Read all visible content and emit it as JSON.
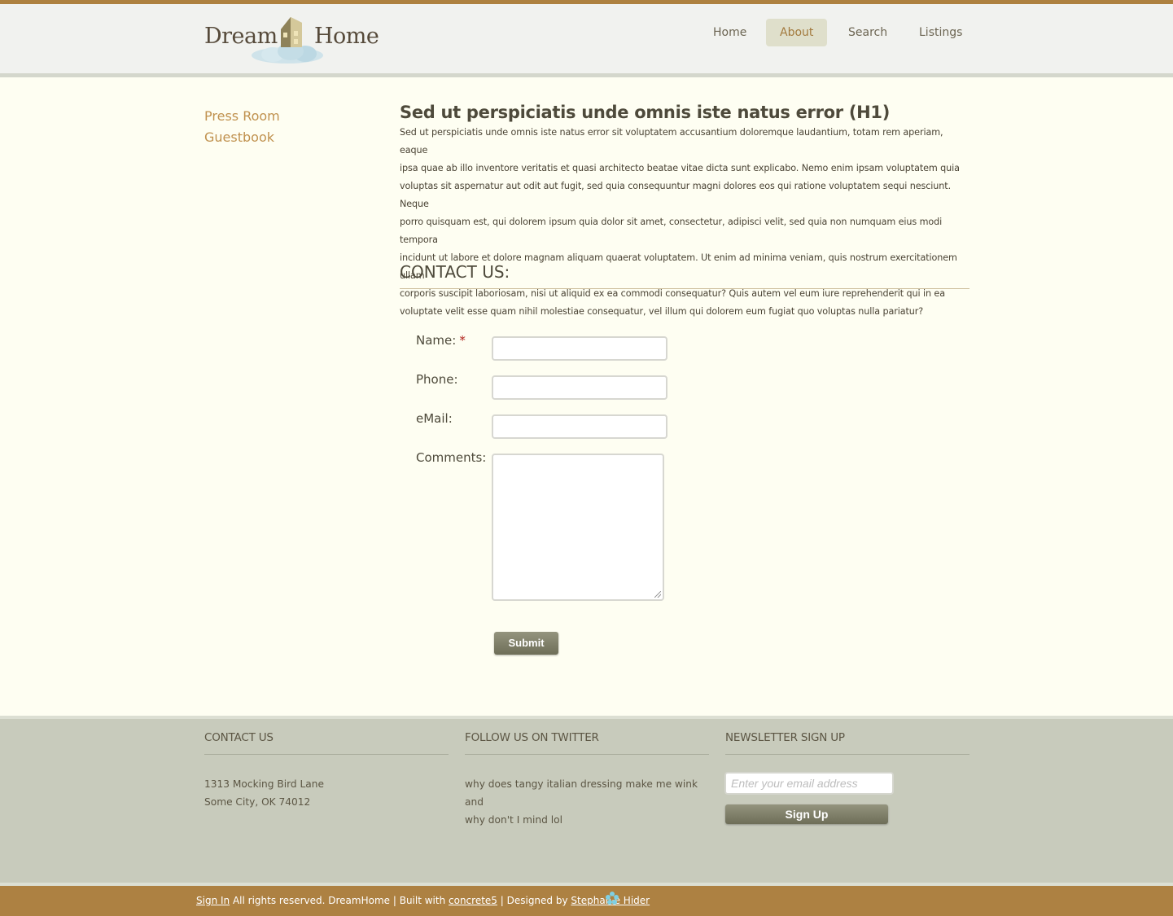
{
  "colors": {
    "accent_bar": "#ae8140",
    "header_bg": "#f1f2ef",
    "page_bg": "#fefef2",
    "link": "#c0914e",
    "footer_bg": "#c8cbbc",
    "button": "#7f7f69"
  },
  "header": {
    "logo_word1": "Dream",
    "logo_word2": "Home",
    "logo_icon": "house-on-cloud-icon",
    "nav": [
      {
        "label": "Home",
        "active": false
      },
      {
        "label": "About",
        "active": true
      },
      {
        "label": "Search",
        "active": false
      },
      {
        "label": "Listings",
        "active": false
      }
    ]
  },
  "sidebar": {
    "items": [
      {
        "label": "Press Room"
      },
      {
        "label": "Guestbook"
      }
    ]
  },
  "main": {
    "title": "Sed ut perspiciatis unde omnis iste natus error (H1)",
    "body_lines": [
      "Sed ut perspiciatis unde omnis iste natus error sit voluptatem accusantium doloremque laudantium, totam rem aperiam, eaque",
      "ipsa quae ab illo inventore veritatis et quasi architecto beatae vitae dicta sunt explicabo. Nemo enim ipsam voluptatem quia",
      "voluptas sit aspernatur aut odit aut fugit, sed quia consequuntur magni dolores eos qui ratione voluptatem sequi nesciunt. Neque",
      "porro quisquam est, qui dolorem ipsum quia dolor sit amet, consectetur, adipisci velit, sed quia non numquam eius modi tempora",
      "incidunt ut labore et dolore magnam aliquam quaerat voluptatem. Ut enim ad minima veniam, quis nostrum exercitationem ullam",
      "corporis suscipit laboriosam, nisi ut aliquid ex ea commodi consequatur? Quis autem vel eum iure reprehenderit qui in ea",
      "voluptate velit esse quam nihil molestiae consequatur, vel illum qui dolorem eum fugiat quo voluptas nulla pariatur?"
    ],
    "contact_heading": "CONTACT US:",
    "form": {
      "name_label": "Name:",
      "required_mark": "*",
      "phone_label": "Phone:",
      "email_label": "eMail:",
      "comments_label": "Comments:",
      "name_value": "",
      "phone_value": "",
      "email_value": "",
      "comments_value": "",
      "submit_label": "Submit"
    }
  },
  "footer": {
    "contact": {
      "heading": "CONTACT US",
      "line1": "1313 Mocking Bird Lane",
      "line2": "Some City, OK 74012"
    },
    "twitter": {
      "heading": "FOLLOW US ON TWITTER",
      "line1": "why does tangy italian dressing make me wink and",
      "line2": "why don't I mind lol"
    },
    "newsletter": {
      "heading": "NEWSLETTER SIGN UP",
      "placeholder": "Enter your email address",
      "button_label": "Sign Up"
    }
  },
  "bottom_bar": {
    "sign_in": "Sign In",
    "rights": " All rights reserved. DreamHome | Built with ",
    "concrete5": "concrete5",
    "designed": " | Designed by ",
    "designer": "Stephanie Hider",
    "icon": "flower-icon"
  }
}
